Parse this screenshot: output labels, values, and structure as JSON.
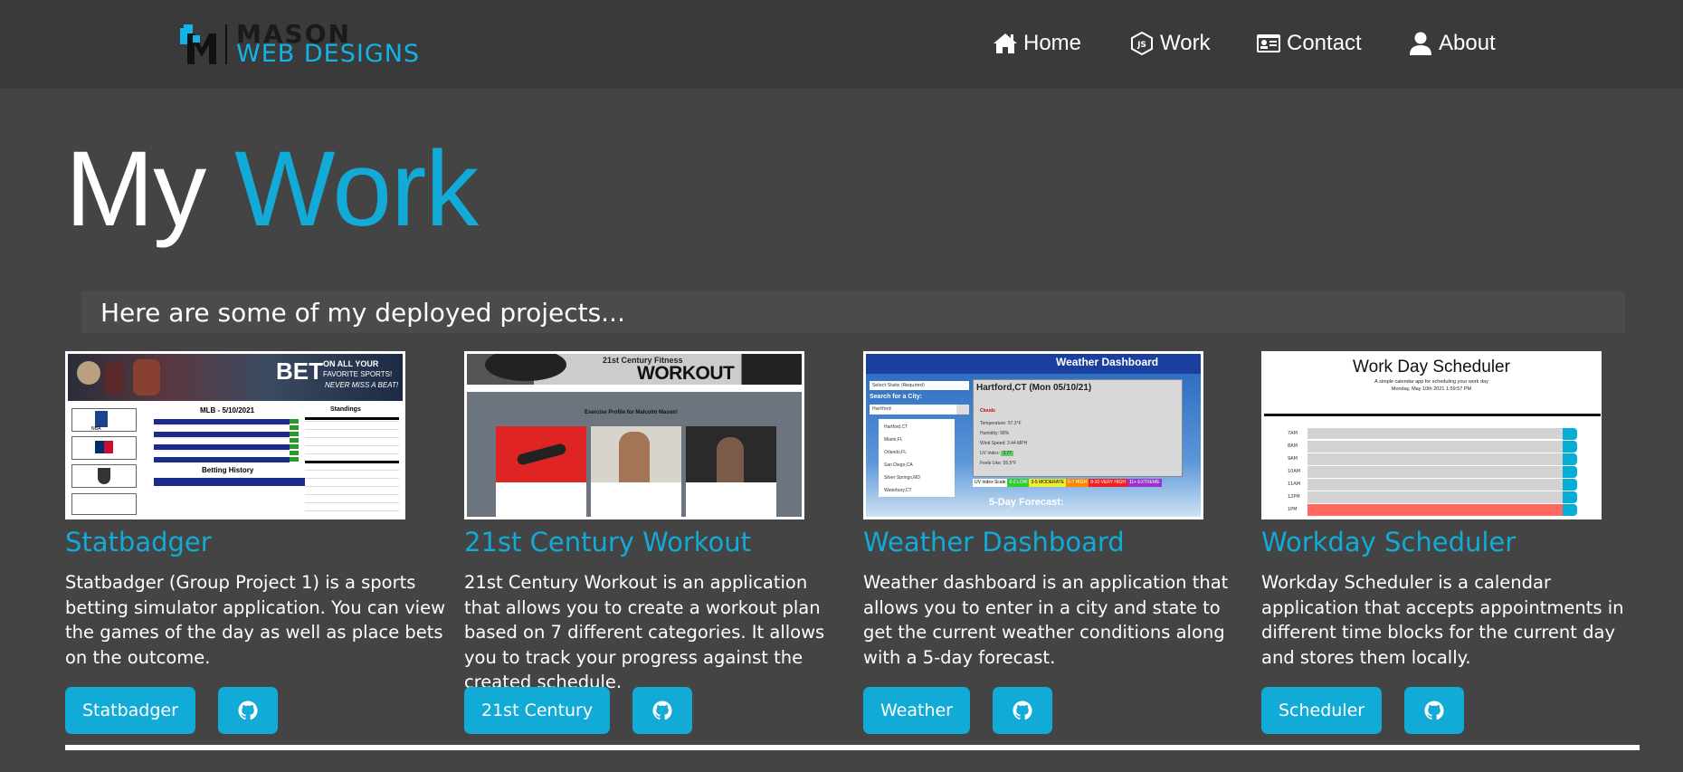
{
  "logo": {
    "line1": "MASON",
    "line2": "WEB DESIGNS"
  },
  "nav": [
    {
      "label": "Home",
      "icon": "home-icon"
    },
    {
      "label": "Work",
      "icon": "js-icon"
    },
    {
      "label": "Contact",
      "icon": "id-card-icon"
    },
    {
      "label": "About",
      "icon": "user-icon"
    }
  ],
  "title": {
    "part1": "My",
    "part2": "Work"
  },
  "intro": "Here are some of my deployed projects...",
  "projects": [
    {
      "title": "Statbadger",
      "description": "Statbadger (Group Project 1) is a sports betting simulator application. You can view the games of the day as well as place bets on the outcome.",
      "button": "Statbadger",
      "thumb": {
        "banner": "BET",
        "banner_sub1": "ON ALL YOUR",
        "banner_sub2": "FAVORITE SPORTS!",
        "banner_sub3": "NEVER MISS A BEAT!",
        "heading": "MLB - 5/10/2021",
        "standings": "Standings",
        "history": "Betting History",
        "nba": "NBA"
      }
    },
    {
      "title": "21st Century Workout",
      "description": "21st Century Workout is an application that allows you to create a workout plan based on 7 different categories. It allows you to track your progress against the created schedule.",
      "button": "21st Century",
      "thumb": {
        "header": "21st Century Fitness",
        "big": "WORKOUT",
        "profile": "Exercise Profile for Malcolm Mason!"
      }
    },
    {
      "title": "Weather Dashboard",
      "description": "Weather dashboard is an application that allows you to enter in a city and state to get the current weather conditions along with a 5-day forecast.",
      "button": "Weather",
      "thumb": {
        "header": "Weather Dashboard",
        "select": "Select State (Required)",
        "search_label": "Search for a City:",
        "search_value": "Hartford",
        "cities": [
          "Hartford,CT",
          "Miami,FL",
          "Orlando,FL",
          "San Diego,CA",
          "Silver Springs,MD",
          "Waterbury,CT"
        ],
        "current": "Hartford,CT (Mon 05/10/21)",
        "condition": "Clouds",
        "temp": "Temperature: 57.3°F",
        "humidity": "Humidity: 58%",
        "wind": "Wind Speed: 3.44 MPH",
        "uv": "UV Index:",
        "uv_value": "3.77",
        "feels": "Feels Like: 55.5°F",
        "uv_scale_label": "UV Index Scale",
        "uv_scale": [
          "0-2 LOW",
          "3-5 MODERATE",
          "6-7 HIGH",
          "8-10 VERY HIGH",
          "11+ EXTREME"
        ],
        "forecast": "5-Day Forecast:"
      }
    },
    {
      "title": "Workday Scheduler",
      "description": "Workday Scheduler is a calendar application that accepts appointments in different time blocks for the current day and stores them locally.",
      "button": "Scheduler",
      "thumb": {
        "heading": "Work Day Scheduler",
        "sub": "A simple calendar app for scheduling your work day",
        "date": "Monday, May 10th 2021 1:59:57 PM",
        "hours": [
          "7AM",
          "8AM",
          "9AM",
          "10AM",
          "11AM",
          "12PM",
          "1PM"
        ]
      }
    }
  ],
  "colors": {
    "accent": "#12aad6",
    "background": "#444444",
    "navbar": "#3a3a3a"
  }
}
